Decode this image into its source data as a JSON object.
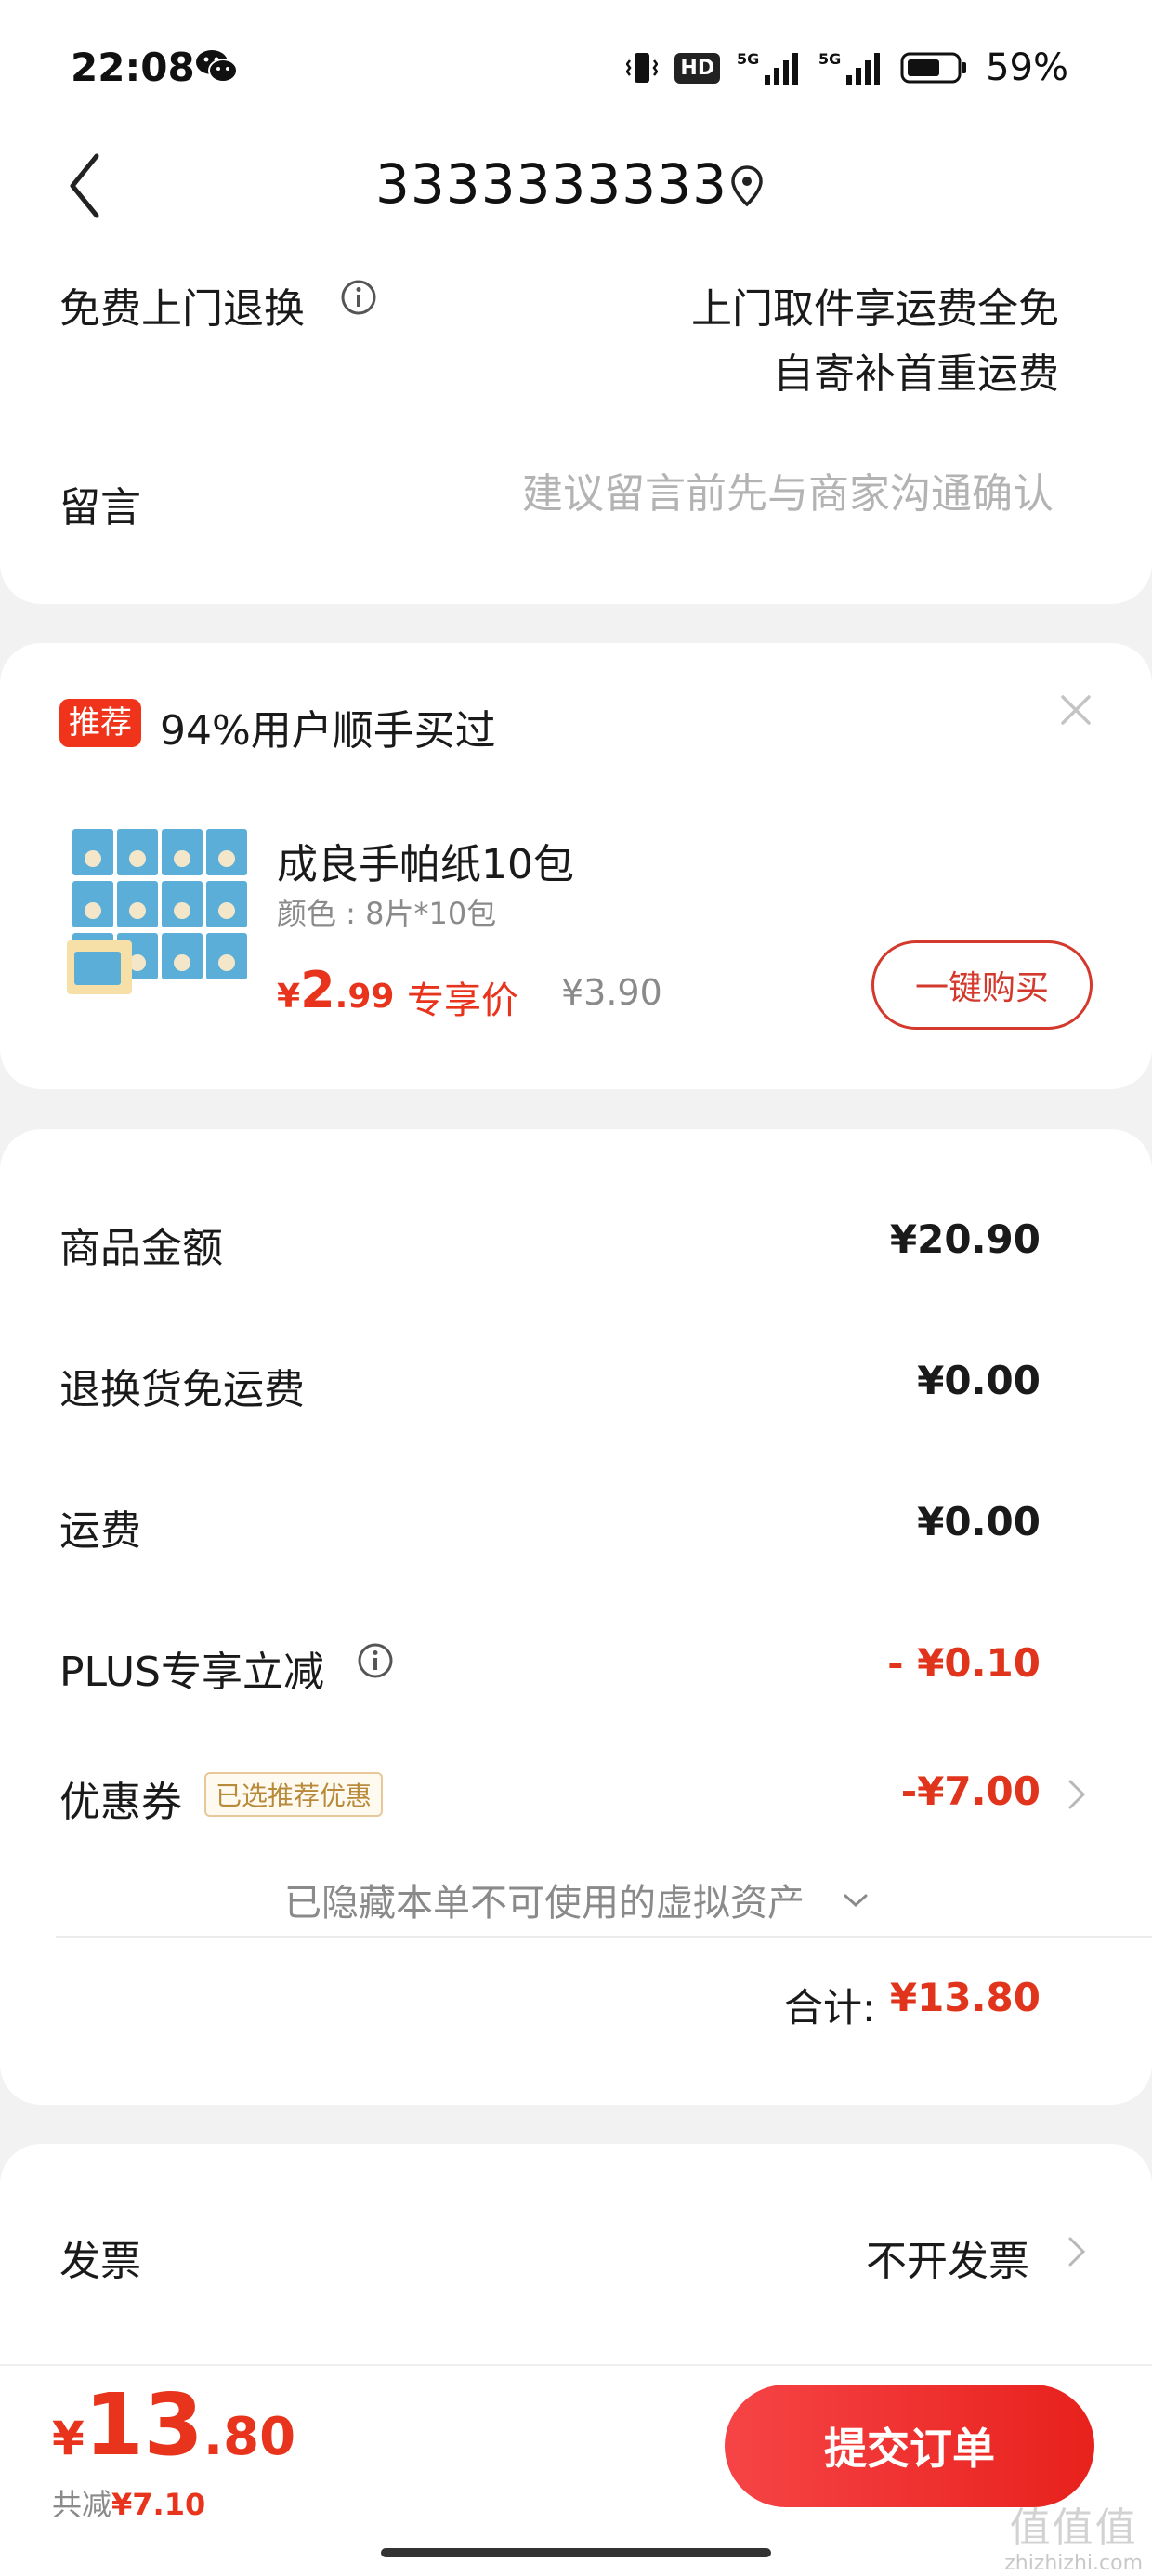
{
  "status_bar": {
    "time": "22:08",
    "hd_badge": "HD",
    "battery_text": "59%",
    "icons": [
      "wechat-icon",
      "vibrate-icon",
      "signal-5g-icon",
      "battery-icon"
    ]
  },
  "header": {
    "title": "3333333333",
    "icons": [
      "back-icon",
      "location-pin-icon"
    ]
  },
  "returns": {
    "label": "免费上门退换",
    "line1": "上门取件享运费全免",
    "line2": "自寄补首重运费"
  },
  "message": {
    "label": "留言",
    "placeholder": "建议留言前先与商家沟通确认"
  },
  "recommend": {
    "badge": "推荐",
    "title": "94%用户顺手买过",
    "product": {
      "name": "成良手帕纸10包",
      "spec": "颜色 : 8片*10包",
      "price_symbol": "¥",
      "price_int": "2",
      "price_dec": ".99",
      "exclusive_label": "专享价",
      "original_price": "¥3.90",
      "buy_label": "一键购买"
    }
  },
  "summary": {
    "rows": [
      {
        "label": "商品金额",
        "value": "¥20.90"
      },
      {
        "label": "退换货免运费",
        "value": "¥0.00"
      },
      {
        "label": "运费",
        "value": "¥0.00"
      },
      {
        "label": "PLUS专享立减",
        "value": "- ¥0.10"
      },
      {
        "label": "优惠券",
        "value": "-¥7.00",
        "tag": "已选推荐优惠"
      }
    ],
    "hidden_note": "已隐藏本单不可使用的虚拟资产",
    "total_label": "合计:",
    "total_value": "¥13.80"
  },
  "invoice": {
    "label": "发票",
    "value": "不开发票"
  },
  "bottom": {
    "price_symbol": "¥",
    "price_int": "13",
    "price_dec": ".80",
    "saved_label": "共减",
    "saved_value": "¥7.10",
    "submit_label": "提交订单"
  },
  "watermark": {
    "mark": "值值值",
    "site": "zhizhizhi.com"
  },
  "colors": {
    "accent": "#e8341c",
    "button_gradient": [
      "#f64446",
      "#e8211c"
    ],
    "muted_text": "#8a8a8a",
    "background": "#f2f2f2"
  }
}
